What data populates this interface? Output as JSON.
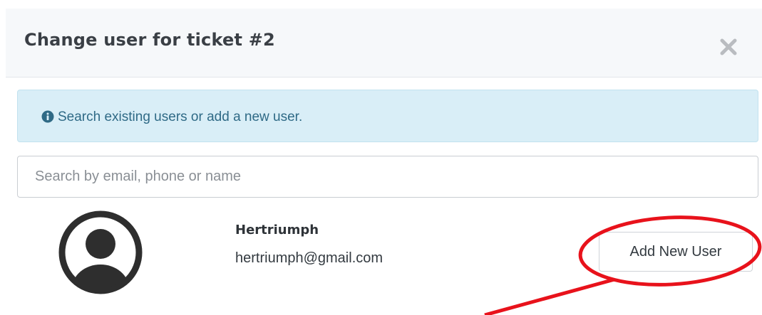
{
  "modal": {
    "title": "Change user for ticket #2",
    "close_icon": "close-icon"
  },
  "alert": {
    "icon": "info-circle-icon",
    "text": "Search existing users or add a new user."
  },
  "search": {
    "placeholder": "Search by email, phone or name",
    "value": ""
  },
  "user": {
    "avatar_icon": "user-avatar-icon",
    "name": "Hertriumph",
    "email": "hertriumph@gmail.com"
  },
  "actions": {
    "add_new_user_label": "Add New User"
  },
  "annotation": {
    "color": "#e8121b",
    "shapes": [
      "ellipse-highlight",
      "arrow"
    ]
  },
  "colors": {
    "header_bg": "#f6f8fa",
    "alert_bg": "#d9eef7",
    "alert_text": "#2f6a86",
    "avatar": "#2e2e2e"
  }
}
